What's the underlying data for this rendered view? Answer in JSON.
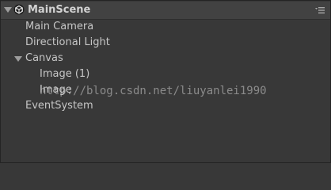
{
  "scene": {
    "name": "MainScene"
  },
  "hierarchy": {
    "main_camera": "Main Camera",
    "directional_light": "Directional Light",
    "canvas": "Canvas",
    "image_1": "Image (1)",
    "image": "Image",
    "event_system": "EventSystem"
  },
  "watermark": "http://blog.csdn.net/liuyanlei1990",
  "colors": {
    "panel_bg": "#383838",
    "header_bg": "#424242",
    "text": "#c6c6c6"
  }
}
